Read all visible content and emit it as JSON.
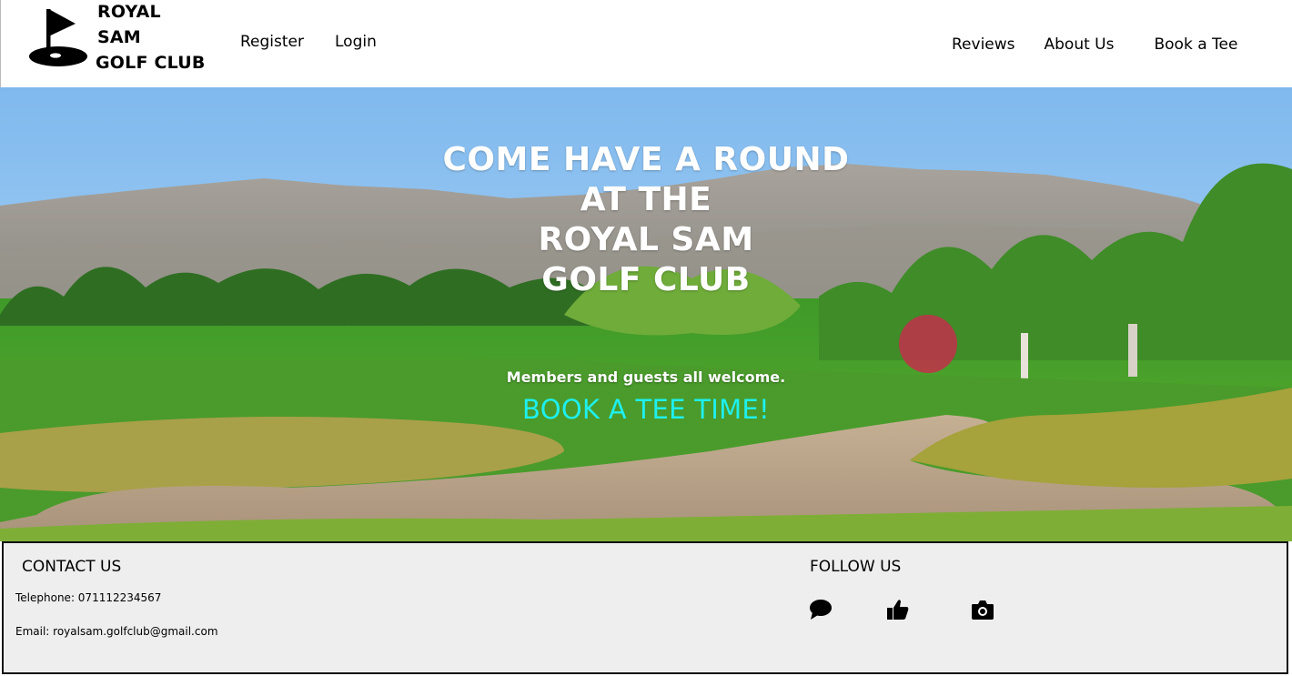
{
  "header": {
    "logo_line1": "ROYAL SAM",
    "logo_line2": "GOLF CLUB",
    "logo_icon": "golf-flag-icon",
    "nav_left": [
      "Register",
      "Login"
    ],
    "nav_right": [
      "Reviews",
      "About Us",
      "Book a Tee"
    ]
  },
  "hero": {
    "title_lines": [
      "COME HAVE A ROUND",
      "AT THE",
      "ROYAL SAM",
      "GOLF CLUB"
    ],
    "subtitle": "Members and guests all welcome.",
    "cta": "BOOK A TEE TIME!",
    "cta_color": "#1ef0f0"
  },
  "footer": {
    "contact_title": "CONTACT US",
    "telephone": "Telephone: 071112234567",
    "email": "Email: royalsam.golfclub@gmail.com",
    "follow_title": "FOLLOW US",
    "social_icons": [
      "comment-icon",
      "thumbs-up-icon",
      "camera-icon"
    ]
  },
  "colors": {
    "footer_bg": "#eeeeee",
    "sky": "#8cc3f0",
    "grass": "#4f9e2c"
  }
}
